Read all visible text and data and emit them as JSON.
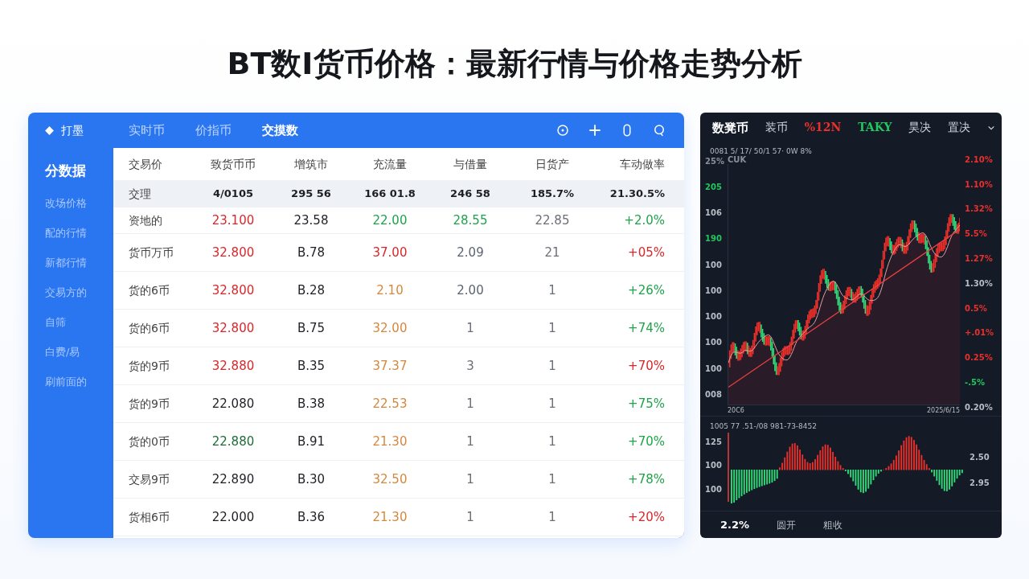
{
  "page_title": "BT数I货币价格：最新行情与价格走势分析",
  "left_panel": {
    "logo": "打墨",
    "tabs": [
      {
        "label": "实时币",
        "selected": false
      },
      {
        "label": "价指币",
        "selected": false
      },
      {
        "label": "交摸数",
        "selected": true
      }
    ],
    "sidebar": {
      "items": [
        {
          "label": "分数据",
          "selected": true
        },
        {
          "label": "改场价格",
          "selected": false
        },
        {
          "label": "配的行情",
          "selected": false
        },
        {
          "label": "新都行情",
          "selected": false
        },
        {
          "label": "交易方的",
          "selected": false
        },
        {
          "label": "自筛",
          "selected": false
        },
        {
          "label": "白费/易",
          "selected": false
        },
        {
          "label": "刷前面的",
          "selected": false
        }
      ]
    },
    "table": {
      "columns": [
        "交易价",
        "致货币币",
        "增筑市",
        "充流量",
        "与借量",
        "日货产",
        "车动做率"
      ],
      "rows": [
        {
          "selected": true,
          "cells": [
            {
              "text": "交理",
              "color": "#444444"
            },
            {
              "text": "4/0105",
              "color": "#1d1f24"
            },
            {
              "text": "295 56",
              "color": "#1d1f24"
            },
            {
              "text": "166 01.8",
              "color": "#1d1f24"
            },
            {
              "text": "246 58",
              "color": "#1d1f24"
            },
            {
              "text": "185.7%",
              "color": "#1d1f24"
            },
            {
              "text": "21.30.5%",
              "color": "#1d1f24"
            }
          ]
        },
        {
          "selected": false,
          "cells": [
            {
              "text": "资地的",
              "color": "#444444"
            },
            {
              "text": "23.100",
              "color": "#d9262a"
            },
            {
              "text": "23.58",
              "color": "#1d1f24"
            },
            {
              "text": "22.00",
              "color": "#1fa34a"
            },
            {
              "text": "28.55",
              "color": "#1fa34a"
            },
            {
              "text": "22.85",
              "color": "#6b6f76"
            },
            {
              "text": "+2.0%",
              "color": "#1fa34a"
            }
          ]
        },
        {
          "selected": false,
          "cells": [
            {
              "text": "货币万币",
              "color": "#444444"
            },
            {
              "text": "32.800",
              "color": "#d9262a"
            },
            {
              "text": "B.78",
              "color": "#1d1f24"
            },
            {
              "text": "37.00",
              "color": "#d9262a"
            },
            {
              "text": "2.09",
              "color": "#5a6473"
            },
            {
              "text": "21",
              "color": "#6b6f76"
            },
            {
              "text": "+05%",
              "color": "#d9262a"
            }
          ]
        },
        {
          "selected": false,
          "cells": [
            {
              "text": "货的6币",
              "color": "#444444"
            },
            {
              "text": "32.800",
              "color": "#d9262a"
            },
            {
              "text": "B.28",
              "color": "#1d1f24"
            },
            {
              "text": "2.10",
              "color": "#d4883e"
            },
            {
              "text": "2.00",
              "color": "#5a6473"
            },
            {
              "text": "1",
              "color": "#6b6f76"
            },
            {
              "text": "+26%",
              "color": "#1fa34a"
            }
          ]
        },
        {
          "selected": false,
          "cells": [
            {
              "text": "货的6币",
              "color": "#444444"
            },
            {
              "text": "32.800",
              "color": "#d9262a"
            },
            {
              "text": "B.75",
              "color": "#1d1f24"
            },
            {
              "text": "32.00",
              "color": "#d4883e"
            },
            {
              "text": "1",
              "color": "#6b6f76"
            },
            {
              "text": "1",
              "color": "#6b6f76"
            },
            {
              "text": "+74%",
              "color": "#1fa34a"
            }
          ]
        },
        {
          "selected": false,
          "cells": [
            {
              "text": "货的9币",
              "color": "#444444"
            },
            {
              "text": "32.880",
              "color": "#d9262a"
            },
            {
              "text": "B.35",
              "color": "#1d1f24"
            },
            {
              "text": "37.37",
              "color": "#d4883e"
            },
            {
              "text": "3",
              "color": "#6b6f76"
            },
            {
              "text": "1",
              "color": "#6b6f76"
            },
            {
              "text": "+70%",
              "color": "#d9262a"
            }
          ]
        },
        {
          "selected": false,
          "cells": [
            {
              "text": "货的9币",
              "color": "#444444"
            },
            {
              "text": "22.080",
              "color": "#1d1f24"
            },
            {
              "text": "B.38",
              "color": "#1d1f24"
            },
            {
              "text": "22.53",
              "color": "#d4883e"
            },
            {
              "text": "1",
              "color": "#6b6f76"
            },
            {
              "text": "1",
              "color": "#6b6f76"
            },
            {
              "text": "+75%",
              "color": "#1fa34a"
            }
          ]
        },
        {
          "selected": false,
          "cells": [
            {
              "text": "货的0币",
              "color": "#444444"
            },
            {
              "text": "22.880",
              "color": "#1f6b3a"
            },
            {
              "text": "B.91",
              "color": "#1d1f24"
            },
            {
              "text": "21.30",
              "color": "#d4883e"
            },
            {
              "text": "1",
              "color": "#6b6f76"
            },
            {
              "text": "1",
              "color": "#6b6f76"
            },
            {
              "text": "+70%",
              "color": "#1fa34a"
            }
          ]
        },
        {
          "selected": false,
          "cells": [
            {
              "text": "交易9币",
              "color": "#444444"
            },
            {
              "text": "22.890",
              "color": "#1d1f24"
            },
            {
              "text": "B.30",
              "color": "#1d1f24"
            },
            {
              "text": "32.50",
              "color": "#d4883e"
            },
            {
              "text": "1",
              "color": "#6b6f76"
            },
            {
              "text": "1",
              "color": "#6b6f76"
            },
            {
              "text": "+78%",
              "color": "#1fa34a"
            }
          ]
        },
        {
          "selected": false,
          "cells": [
            {
              "text": "货相6币",
              "color": "#444444"
            },
            {
              "text": "22.000",
              "color": "#1d1f24"
            },
            {
              "text": "B.36",
              "color": "#1d1f24"
            },
            {
              "text": "21.30",
              "color": "#d4883e"
            },
            {
              "text": "1",
              "color": "#6b6f76"
            },
            {
              "text": "1",
              "color": "#6b6f76"
            },
            {
              "text": "+20%",
              "color": "#d9262a"
            }
          ]
        }
      ]
    }
  },
  "right_panel": {
    "header": [
      {
        "label": "数凳币",
        "selected": true,
        "color": "#ffffff"
      },
      {
        "label": "装币",
        "selected": false,
        "color": "#d0d4dc"
      },
      {
        "label": "%12N",
        "selected": false,
        "color": "#e8302c"
      },
      {
        "label": "TAKY",
        "selected": false,
        "color": "#22c55e"
      },
      {
        "label": "昊决",
        "selected": false,
        "color": "#d0d4dc"
      },
      {
        "label": "置决",
        "selected": false,
        "color": "#d0d4dc"
      }
    ],
    "price_chart": {
      "subtitle": "0081 5/ 17/ 50/1 57· 0W 8%",
      "corner_label": "CUK",
      "left_axis": [
        {
          "text": "25%",
          "color": "#8a8f99"
        },
        {
          "text": "205",
          "color": "#22c55e"
        },
        {
          "text": "106",
          "color": "#b8bcc4"
        },
        {
          "text": "190",
          "color": "#22c55e"
        },
        {
          "text": "100",
          "color": "#b8bcc4"
        },
        {
          "text": "100",
          "color": "#b8bcc4"
        },
        {
          "text": "100",
          "color": "#b8bcc4"
        },
        {
          "text": "100",
          "color": "#b8bcc4"
        },
        {
          "text": "100",
          "color": "#b8bcc4"
        },
        {
          "text": "008",
          "color": "#b8bcc4"
        }
      ],
      "right_axis": [
        {
          "text": "2.10%",
          "color": "#e8302c"
        },
        {
          "text": "1.10%",
          "color": "#e8302c"
        },
        {
          "text": "1.32%",
          "color": "#e8302c"
        },
        {
          "text": "5.5%",
          "color": "#e8302c"
        },
        {
          "text": "1.27%",
          "color": "#e8302c"
        },
        {
          "text": "1.30%",
          "color": "#b8bcc4"
        },
        {
          "text": "0.5%",
          "color": "#e8302c"
        },
        {
          "text": "+.01%",
          "color": "#e8302c"
        },
        {
          "text": "0.25%",
          "color": "#e8302c"
        },
        {
          "text": "-.5%",
          "color": "#22c55e"
        },
        {
          "text": "0.20%",
          "color": "#b8bcc4"
        }
      ],
      "x_labels": [
        "20C6",
        "2025/6/15"
      ]
    },
    "histogram": {
      "subtitle": "1005 77 .51-/08 981-73-8452",
      "left_axis": [
        "125",
        "100",
        "100"
      ],
      "right_axis": [
        "2.50",
        "2.95"
      ]
    },
    "footer": [
      {
        "label": "2.2%",
        "selected": true
      },
      {
        "label": "圆开",
        "selected": false
      },
      {
        "label": "粗收",
        "selected": false
      }
    ]
  }
}
